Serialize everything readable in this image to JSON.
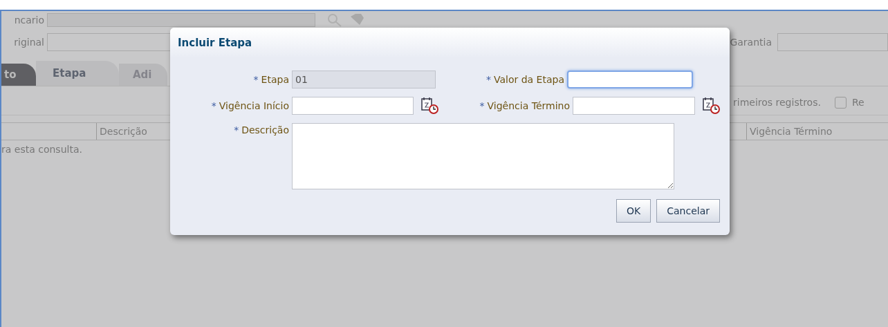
{
  "background": {
    "fields": [
      {
        "label": "ncario"
      },
      {
        "label": "riginal"
      }
    ],
    "garantia": {
      "label": "Garantia"
    },
    "tabs": [
      {
        "label": "to",
        "selected": false
      },
      {
        "label": "Etapa",
        "selected": true
      },
      {
        "label": "Adi",
        "selected": false
      }
    ],
    "toolbar": {
      "text": "rimeiros registros.",
      "checkbox": {
        "label": "Re",
        "checked": false
      }
    },
    "table": {
      "columns": [
        "Descrição",
        "Vigência Término"
      ],
      "message": "ra esta consulta."
    }
  },
  "dialog": {
    "title": "Incluir Etapa",
    "fields": [
      {
        "kind": "text",
        "marker": "*",
        "label": "Etapa",
        "value": "01",
        "disabled": true,
        "focused": false
      },
      {
        "kind": "text",
        "marker": "*",
        "label": "Valor da Etapa",
        "disabled": false,
        "focused": true
      },
      {
        "kind": "date",
        "marker": "*",
        "label": "Vigência Início",
        "disabled": false,
        "focused": false
      },
      {
        "kind": "date",
        "marker": "*",
        "label": "Vigência Término",
        "disabled": false,
        "focused": false
      },
      {
        "kind": "textarea",
        "marker": "*",
        "label": "Descrição",
        "disabled": false,
        "focused": false
      }
    ],
    "buttons": [
      "OK",
      "Cancelar"
    ]
  }
}
